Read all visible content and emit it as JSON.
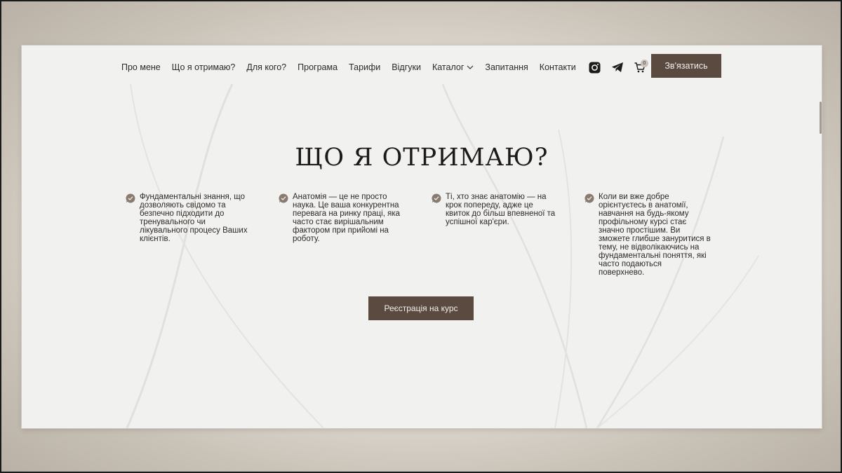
{
  "nav": {
    "items": [
      {
        "label": "Про мене"
      },
      {
        "label": "Що я отримаю?"
      },
      {
        "label": "Для кого?"
      },
      {
        "label": "Програма"
      },
      {
        "label": "Тарифи"
      },
      {
        "label": "Відгуки"
      },
      {
        "label": "Каталог",
        "has_dropdown": true
      },
      {
        "label": "Запитання"
      },
      {
        "label": "Контакти"
      }
    ],
    "icons": [
      "instagram-icon",
      "telegram-icon",
      "cart-icon"
    ],
    "cart_count": "0",
    "contact_label": "Зв'язатись"
  },
  "section": {
    "title": "ЩО Я ОТРИМАЮ?",
    "features": [
      {
        "lines": [
          "Фундаментальні знання, що",
          "дозволяють свідомо та",
          "безпечно підходити до",
          "тренувального чи",
          "лікувального процесу Ваших",
          "клієнтів."
        ]
      },
      {
        "lines": [
          "Анатомія — це не просто",
          "наука. Це ваша конкурентна",
          "перевага на ринку праці, яка",
          "часто стає вирішальним",
          "фактором при прийомі на",
          "роботу."
        ]
      },
      {
        "lines": [
          "Ті, хто знає анатомію — на",
          "крок попереду, адже це",
          "квиток до більш впевненої та",
          "успішної кар'єри."
        ]
      },
      {
        "lines": [
          "Коли ви вже добре",
          "орієнтуєтесь в анатомії,",
          "навчання на будь-якому",
          "профільному курсі стає",
          "значно простішим. Ви",
          "зможете глибше зануритися в",
          "тему, не відволікаючись на",
          "фундаментальні поняття, які",
          "часто подаються",
          "поверхнево."
        ]
      }
    ],
    "register_label": "Реєстрація на курс"
  },
  "colors": {
    "accent": "#5b4a40",
    "check_icon": "#8a7b70",
    "text": "#2f2a26",
    "page_bg": "#f1f1f0"
  }
}
